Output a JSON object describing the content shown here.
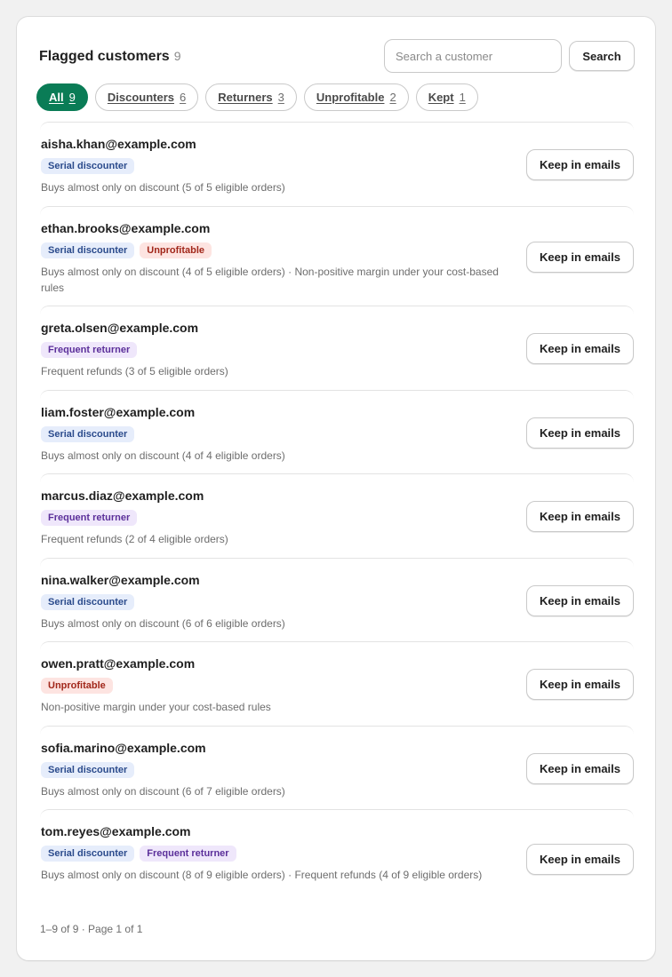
{
  "header": {
    "title": "Flagged customers",
    "count": "9",
    "search_placeholder": "Search a customer",
    "search_value": "",
    "search_button": "Search"
  },
  "tabs": [
    {
      "label": "All",
      "count": "9",
      "active": true
    },
    {
      "label": "Discounters",
      "count": "6",
      "active": false
    },
    {
      "label": "Returners",
      "count": "3",
      "active": false
    },
    {
      "label": "Unprofitable",
      "count": "2",
      "active": false
    },
    {
      "label": "Kept",
      "count": "1",
      "active": false
    }
  ],
  "badges": {
    "serial": "Serial discounter",
    "unprofitable": "Unprofitable",
    "returner": "Frequent returner"
  },
  "keep_label": "Keep in emails",
  "customers": [
    {
      "email": "aisha.khan@example.com",
      "badges": [
        "serial"
      ],
      "desc": "Buys almost only on discount (5 of 5 eligible orders)"
    },
    {
      "email": "ethan.brooks@example.com",
      "badges": [
        "serial",
        "unprofitable"
      ],
      "desc": "Buys almost only on discount (4 of 5 eligible orders) · Non-positive margin under your cost-based rules"
    },
    {
      "email": "greta.olsen@example.com",
      "badges": [
        "returner"
      ],
      "desc": "Frequent refunds (3 of 5 eligible orders)"
    },
    {
      "email": "liam.foster@example.com",
      "badges": [
        "serial"
      ],
      "desc": "Buys almost only on discount (4 of 4 eligible orders)"
    },
    {
      "email": "marcus.diaz@example.com",
      "badges": [
        "returner"
      ],
      "desc": "Frequent refunds (2 of 4 eligible orders)"
    },
    {
      "email": "nina.walker@example.com",
      "badges": [
        "serial"
      ],
      "desc": "Buys almost only on discount (6 of 6 eligible orders)"
    },
    {
      "email": "owen.pratt@example.com",
      "badges": [
        "unprofitable"
      ],
      "desc": "Non-positive margin under your cost-based rules"
    },
    {
      "email": "sofia.marino@example.com",
      "badges": [
        "serial"
      ],
      "desc": "Buys almost only on discount (6 of 7 eligible orders)"
    },
    {
      "email": "tom.reyes@example.com",
      "badges": [
        "serial",
        "returner"
      ],
      "desc": "Buys almost only on discount (8 of 9 eligible orders) · Frequent refunds (4 of 9 eligible orders)"
    }
  ],
  "footer": "1–9 of 9 · Page 1 of 1",
  "colors": {
    "accent": "#0a7c56",
    "serial_bg": "#e6edfb",
    "unprofitable_bg": "#fde4e1",
    "returner_bg": "#efe7fb"
  }
}
